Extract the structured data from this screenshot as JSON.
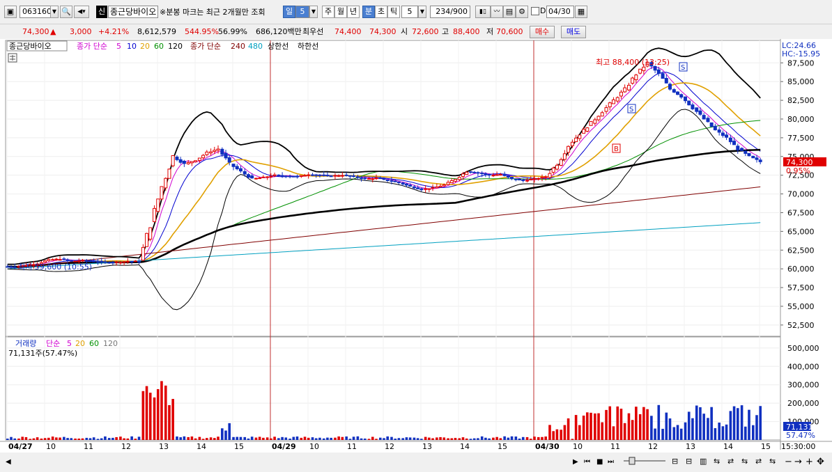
{
  "toolbar": {
    "code": "063160",
    "sin_label": "신",
    "stock_name": "종근당바이오",
    "note": "※분봉 마크는 최근 2개월만 조회",
    "period_day": "일",
    "period_num": "5",
    "week": "주",
    "month": "월",
    "year": "년",
    "minute": "분",
    "second": "초",
    "tick": "틱",
    "interval": "5",
    "count": "234/900",
    "date_check": "D",
    "date": "04/30"
  },
  "quote": {
    "price": "74,300",
    "change_arrow": "▲",
    "change": "3,000",
    "change_pct": "+4.21%",
    "volume": "8,612,579",
    "vol_ratio": "544.95%",
    "turnover": "56.99%",
    "amount": "686,120백만",
    "best_bid_label": "최우선",
    "ask": "74,400",
    "bid": "74,300",
    "open_label": "시",
    "open": "72,600",
    "high_label": "고",
    "high": "88,400",
    "low_label": "저",
    "low": "70,600",
    "buy": "매수",
    "sell": "매도"
  },
  "legend": {
    "name": "종근당바이오",
    "ma_prefix": "종가 단순",
    "ma5": "5",
    "ma10": "10",
    "ma20": "20",
    "ma60": "60",
    "ma120": "120",
    "ma2_prefix": "종가 단순",
    "ma240": "240",
    "ma480": "480",
    "upper": "상한선",
    "lower": "하한선"
  },
  "colors": {
    "up": "#e00000",
    "down": "#1030c0",
    "ma5": "#d000d0",
    "ma10": "#0000d0",
    "ma20": "#e0a000",
    "ma60": "#009000",
    "ma120": "#000000",
    "ma240": "#800000",
    "ma480": "#00a0c0"
  },
  "annotations": {
    "high": "최고 88,400 (13:25)",
    "low": "최저 59,600 (10:55)",
    "lc": "LC:24.66",
    "hc": "HC:-15.95",
    "price_tag": "74,300",
    "pct_tag": "0.95%",
    "vol_tag": "71,131",
    "vol_pct_tag": "57.47%",
    "mark_s": "S",
    "mark_b": "B"
  },
  "volume_legend": {
    "title": "거래량",
    "ma_prefix": "단순",
    "ma5": "5",
    "ma20": "20",
    "ma60": "60",
    "ma120": "120",
    "value": "71,131주(57.47%)"
  },
  "chart_data": {
    "type": "candlestick",
    "price_axis": [
      "87,500",
      "85,000",
      "82,500",
      "80,000",
      "77,500",
      "75,000",
      "72,500",
      "70,000",
      "67,500",
      "65,000",
      "62,500",
      "60,000",
      "57,500",
      "55,000",
      "52,500"
    ],
    "volume_axis": [
      "500,000",
      "400,000",
      "300,000",
      "200,000",
      "100,000"
    ],
    "time_axis": [
      "04/27",
      "10",
      "11",
      "12",
      "13",
      "14",
      "15",
      "04/29",
      "10",
      "11",
      "12",
      "13",
      "14",
      "15",
      "04/30",
      "10",
      "11",
      "12",
      "13",
      "14",
      "15"
    ],
    "time_right": "15:30:00",
    "ylim": [
      51000,
      90500
    ],
    "close_path": [
      60300,
      60500,
      60700,
      61200,
      61300,
      61000,
      61100,
      61000,
      60900,
      60900,
      61000,
      61000,
      66000,
      71000,
      75000,
      74000,
      74500,
      75500,
      76000,
      74000,
      73000,
      72000,
      72200,
      72500,
      72400,
      72300,
      72600,
      72500,
      72400,
      72500,
      72300,
      72000,
      72100,
      71800,
      71500,
      71000,
      70600,
      70800,
      71200,
      72000,
      73000,
      72800,
      72500,
      72600,
      72000,
      71800,
      72000,
      72300,
      74000,
      76500,
      78000,
      79500,
      81000,
      82500,
      84000,
      86000,
      87500,
      86000,
      84000,
      83000,
      81500,
      80000,
      78500,
      77500,
      76000,
      75000,
      74300
    ],
    "bars_per_session": 66
  }
}
